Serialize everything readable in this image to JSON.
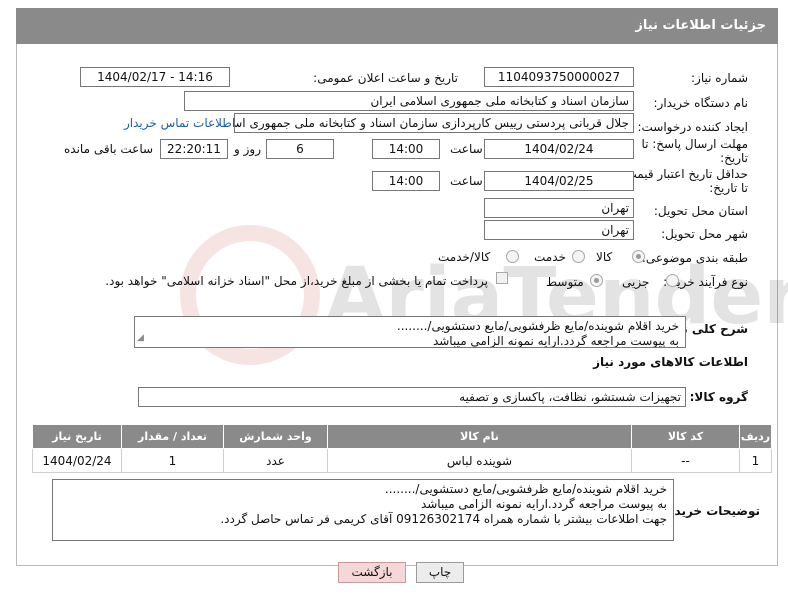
{
  "header": {
    "title": "جزئیات اطلاعات نیاز"
  },
  "fields": {
    "need_number_label": "شماره نیاز:",
    "need_number": "1104093750000027",
    "announce_label": "تاریخ و ساعت اعلان عمومی:",
    "announce_value": "1404/02/17 - 14:16",
    "buyer_org_label": "نام دستگاه خریدار:",
    "buyer_org": "سازمان اسناد و کتابخانه ملی جمهوری اسلامی ایران",
    "creator_label": "ایجاد کننده درخواست:",
    "creator": "جلال قربانی پردستی رییس کارپردازی سازمان اسناد و کتابخانه ملی جمهوری اس",
    "buyer_contact_link": "اطلاعات تماس خریدار",
    "reply_deadline_label": "مهلت ارسال پاسخ: تا تاریخ:",
    "reply_date": "1404/02/24",
    "time_label": "ساعت",
    "reply_time": "14:00",
    "days_value": "6",
    "days_label": "روز و",
    "remaining_time": "22:20:11",
    "remaining_label": "ساعت باقی مانده",
    "price_deadline_label": "حداقل تاریخ اعتبار قیمت: تا تاریخ:",
    "price_date": "1404/02/25",
    "price_time": "14:00",
    "province_label": "استان محل تحویل:",
    "province": "تهران",
    "city_label": "شهر محل تحویل:",
    "city": "تهران",
    "category_label": "طبقه بندی موضوعی:",
    "category_options": [
      "کالا",
      "خدمت",
      "کالا/خدمت"
    ],
    "process_label": "نوع فرآیند خرید :",
    "process_options": [
      "جزیی",
      "متوسط"
    ],
    "payment_note": "پرداخت تمام یا بخشی از مبلغ خرید،از محل \"اسناد خزانه اسلامی\" خواهد بود."
  },
  "description": {
    "label": "شرح کلی نیاز:",
    "lines": [
      "خرید اقلام شوینده/مایع ظرفشویی/مایع دستشویی/........",
      "به پیوست مراجعه گردد.ارایه نمونه الزامی میباشد"
    ]
  },
  "goods_info_label": "اطلاعات کالاهای مورد نیاز",
  "goods_group": {
    "label": "گروه کالا:",
    "value": "تجهیزات شستشو، نظافت، پاکسازی و تصفیه"
  },
  "table": {
    "headers": [
      "ردیف",
      "کد کالا",
      "نام کالا",
      "واحد شمارش",
      "تعداد / مقدار",
      "تاریخ نیاز"
    ],
    "rows": [
      [
        "1",
        "--",
        "شوینده لباس",
        "عدد",
        "1",
        "1404/02/24"
      ]
    ]
  },
  "buyer_notes": {
    "label": "توضیحات خریدار:",
    "lines": [
      "خرید اقلام شوینده/مایع ظرفشویی/مایع دستشویی/........",
      "به پیوست مراجعه گردد.ارایه نمونه الزامی میباشد",
      "جهت اطلاعات بیشتر با شماره همراه 09126302174 آقای کریمی فر تماس حاصل گردد."
    ]
  },
  "buttons": {
    "print": "چاپ",
    "back": "بازگشت"
  },
  "watermark_text": "AriaTender.neT"
}
